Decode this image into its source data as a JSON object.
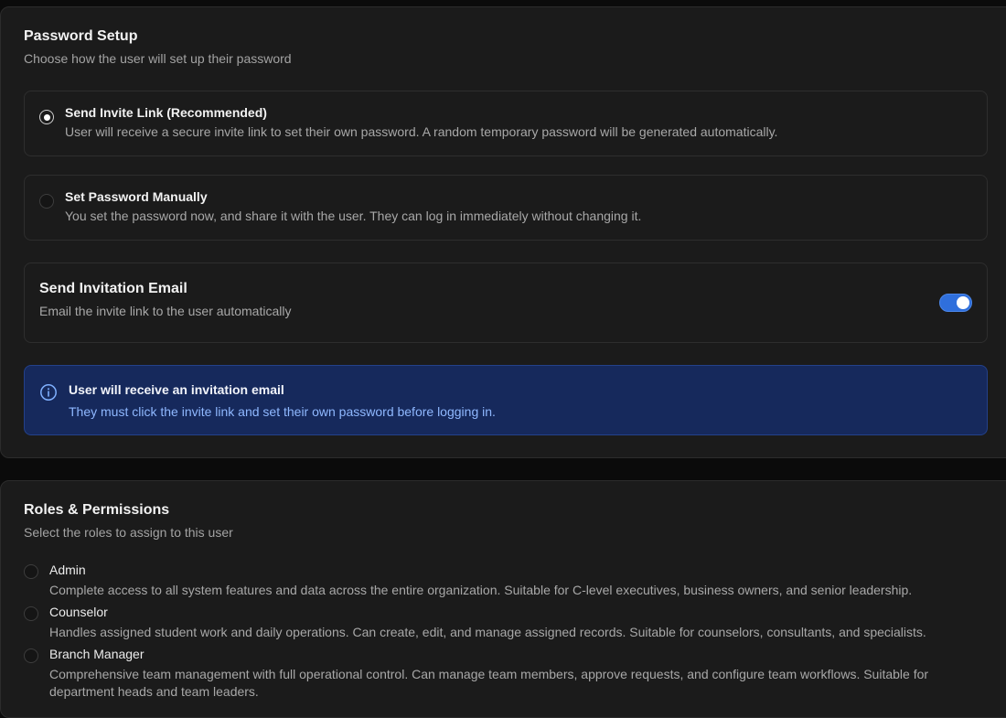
{
  "password_setup": {
    "title": "Password Setup",
    "subtitle": "Choose how the user will set up their password",
    "options": [
      {
        "title": "Send Invite Link (Recommended)",
        "description": "User will receive a secure invite link to set their own password. A random temporary password will be generated automatically.",
        "selected": true
      },
      {
        "title": "Set Password Manually",
        "description": "You set the password now, and share it with the user. They can log in immediately without changing it.",
        "selected": false
      }
    ],
    "invitation_email": {
      "title": "Send Invitation Email",
      "description": "Email the invite link to the user automatically",
      "enabled": true
    },
    "info_banner": {
      "icon": "info-icon",
      "title": "User will receive an invitation email",
      "description": "They must click the invite link and set their own password before logging in."
    }
  },
  "roles": {
    "title": "Roles & Permissions",
    "subtitle": "Select the roles to assign to this user",
    "items": [
      {
        "name": "Admin",
        "description": "Complete access to all system features and data across the entire organization. Suitable for C-level executives, business owners, and senior leadership."
      },
      {
        "name": "Counselor",
        "description": "Handles assigned student work and daily operations. Can create, edit, and manage assigned records. Suitable for counselors, consultants, and specialists."
      },
      {
        "name": "Branch Manager",
        "description": "Comprehensive team management with full operational control. Can manage team members, approve requests, and configure team workflows. Suitable for department heads and team leaders."
      }
    ]
  },
  "colors": {
    "background": "#0b0b0b",
    "card": "#1b1b1b",
    "accent": "#2f6fdc",
    "info_background": "#16295c",
    "info_text": "#8fb8ff"
  }
}
